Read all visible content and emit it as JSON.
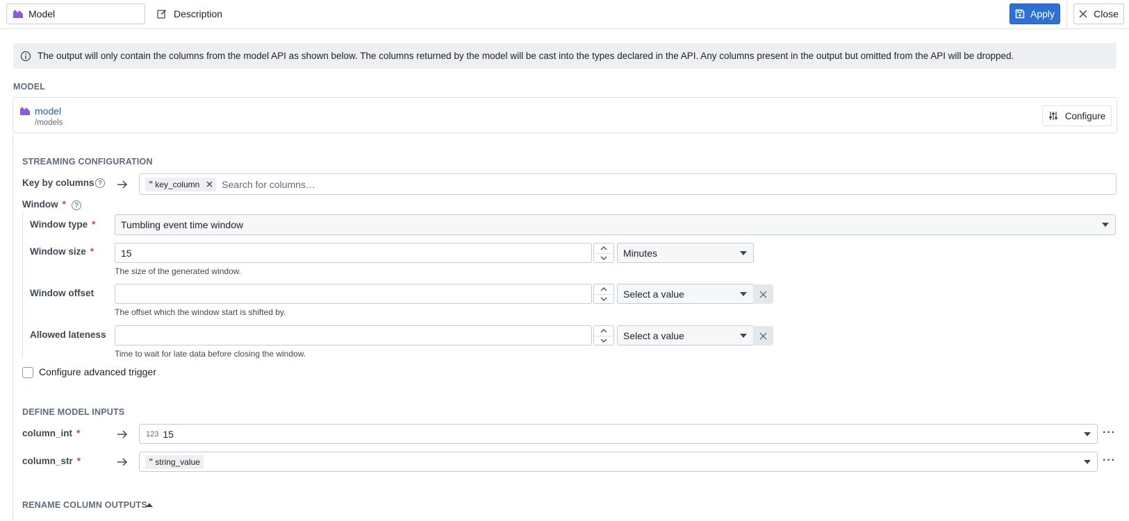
{
  "header": {
    "name_value": "Model",
    "description_label": "Description",
    "apply_label": "Apply",
    "close_label": "Close"
  },
  "callout": {
    "text": "The output will only contain the columns from the model API as shown below. The columns returned by the model will be cast into the types declared in the API. Any columns present in the output but omitted from the API will be dropped."
  },
  "model_section": {
    "title": "MODEL",
    "model_name": "model",
    "model_path": "/models",
    "configure_label": "Configure"
  },
  "streaming": {
    "title": "STREAMING CONFIGURATION",
    "key_by": {
      "label": "Key by columns",
      "tags": [
        "key_column"
      ],
      "placeholder": "Search for columns…"
    },
    "window": {
      "label": "Window",
      "required_mark": "*",
      "window_type": {
        "label": "Window type",
        "required_mark": "*",
        "value": "Tumbling event time window"
      },
      "window_size": {
        "label": "Window size",
        "required_mark": "*",
        "value": "15",
        "unit": "Minutes",
        "hint": "The size of the generated window."
      },
      "window_offset": {
        "label": "Window offset",
        "value": "",
        "unit_placeholder": "Select a value",
        "hint": "The offset which the window start is shifted by."
      },
      "allowed_lateness": {
        "label": "Allowed lateness",
        "value": "",
        "unit_placeholder": "Select a value",
        "hint": "Time to wait for late data before closing the window."
      }
    },
    "advanced_trigger": {
      "label": "Configure advanced trigger",
      "checked": false
    }
  },
  "inputs": {
    "title": "DEFINE MODEL INPUTS",
    "rows": [
      {
        "name": "column_int",
        "required_mark": "*",
        "type_indicator": "123",
        "value": "15"
      },
      {
        "name": "column_str",
        "required_mark": "*",
        "value_tag": "string_value"
      }
    ]
  },
  "rename": {
    "title": "RENAME COLUMN OUTPUTS"
  },
  "colors": {
    "primary": "#2d72d2",
    "required": "#cd4246",
    "model_icon": "#8c5cd6",
    "link": "#215db0"
  },
  "icons": [
    "model-icon",
    "edit-icon",
    "save-icon",
    "close-icon",
    "info-icon",
    "sliders-icon",
    "help-icon",
    "arrow-right-icon",
    "quote-icon",
    "caret-down-icon",
    "chevron-up-icon",
    "chevron-down-icon",
    "more-icon",
    "caret-up-icon"
  ]
}
